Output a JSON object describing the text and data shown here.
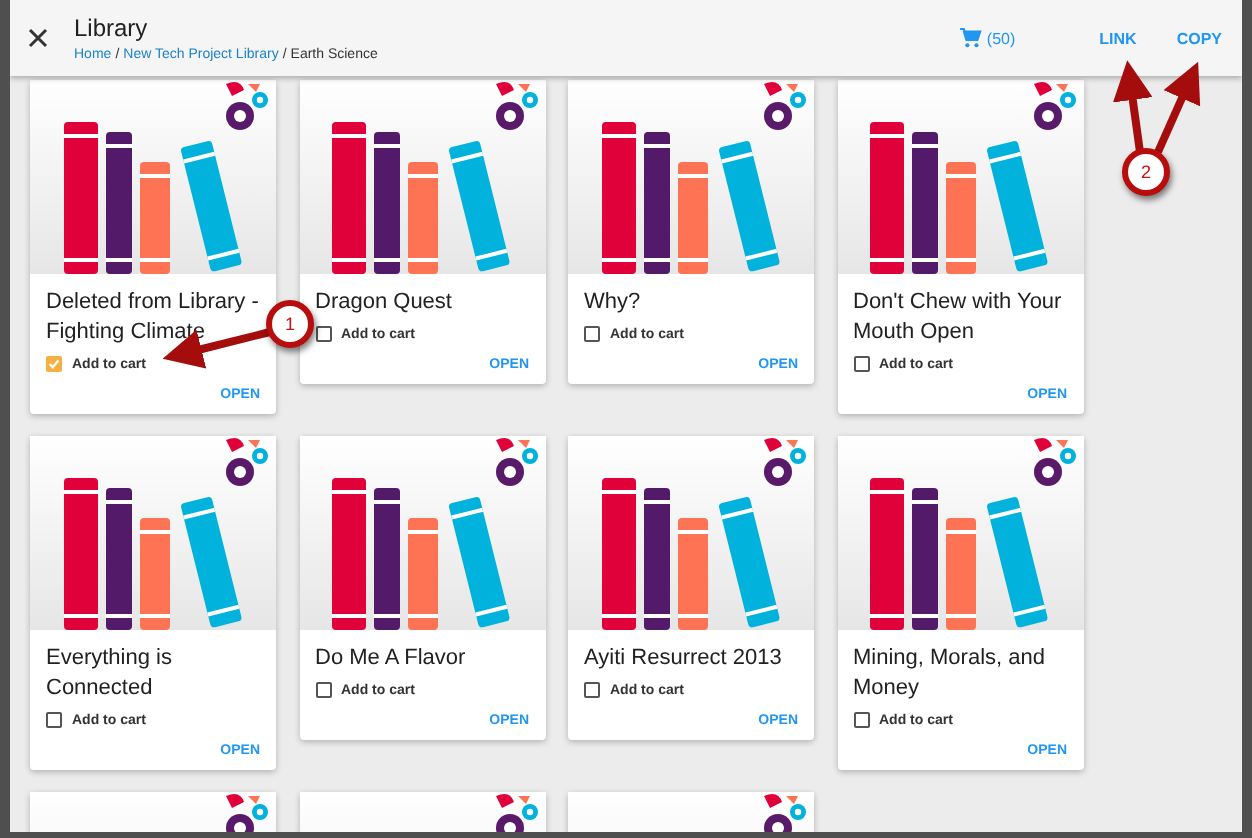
{
  "header": {
    "title": "Library",
    "breadcrumb": [
      {
        "label": "Home",
        "link": true
      },
      {
        "separator": "/",
        "label": "New Tech Project Library",
        "link": true
      },
      {
        "separator": "/",
        "label": "Earth Science",
        "link": false
      }
    ],
    "cart_count": "(50)",
    "actions": [
      "LINK",
      "COPY"
    ]
  },
  "cards": [
    {
      "kind": "full",
      "title": "Deleted from Library - Fighting Climate",
      "checkbox_label": "Add to cart",
      "checked": true,
      "action": "OPEN"
    },
    {
      "kind": "full",
      "title": "Dragon Quest",
      "checkbox_label": "Add to cart",
      "checked": false,
      "action": "OPEN"
    },
    {
      "kind": "full",
      "title": "Why?",
      "checkbox_label": "Add to cart",
      "checked": false,
      "action": "OPEN"
    },
    {
      "kind": "full",
      "title": "Don't Chew with Your Mouth Open",
      "checkbox_label": "Add to cart",
      "checked": false,
      "action": "OPEN"
    },
    {
      "kind": "full",
      "title": "Everything is Connected",
      "checkbox_label": "Add to cart",
      "checked": false,
      "action": "OPEN"
    },
    {
      "kind": "full",
      "title": "Do Me A Flavor",
      "checkbox_label": "Add to cart",
      "checked": false,
      "action": "OPEN"
    },
    {
      "kind": "full",
      "title": "Ayiti Resurrect 2013",
      "checkbox_label": "Add to cart",
      "checked": false,
      "action": "OPEN"
    },
    {
      "kind": "full",
      "title": "Mining, Morals, and Money",
      "checkbox_label": "Add to cart",
      "checked": false,
      "action": "OPEN"
    },
    {
      "kind": "cut"
    },
    {
      "kind": "cut"
    },
    {
      "kind": "cut"
    }
  ],
  "annotations": [
    {
      "label": "1"
    },
    {
      "label": "2"
    }
  ]
}
